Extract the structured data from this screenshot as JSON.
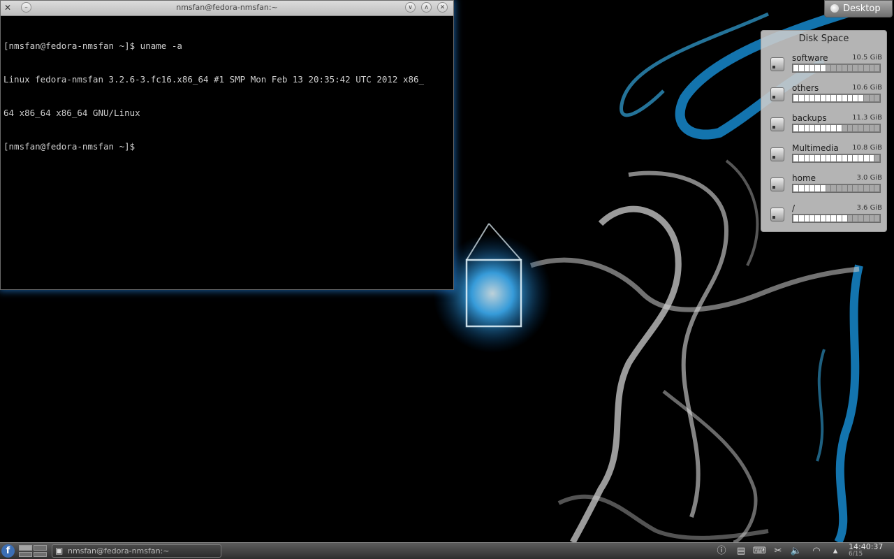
{
  "terminal": {
    "title": "nmsfan@fedora-nmsfan:~",
    "lines": [
      "[nmsfan@fedora-nmsfan ~]$ uname -a",
      "Linux fedora-nmsfan 3.2.6-3.fc16.x86_64 #1 SMP Mon Feb 13 20:35:42 UTC 2012 x86_",
      "64 x86_64 x86_64 GNU/Linux",
      "[nmsfan@fedora-nmsfan ~]$"
    ],
    "buttons": [
      "chevron-down-icon",
      "chevron-up-icon",
      "close-icon"
    ]
  },
  "desktop_button": {
    "label": "Desktop"
  },
  "disk_widget": {
    "title": "Disk Space",
    "disks": [
      {
        "name": "software",
        "size": "10.5 GiB",
        "used_fraction": 0.4
      },
      {
        "name": "others",
        "size": "10.6 GiB",
        "used_fraction": 0.8
      },
      {
        "name": "backups",
        "size": "11.3 GiB",
        "used_fraction": 0.55
      },
      {
        "name": "Multimedia",
        "size": "10.8 GiB",
        "used_fraction": 0.95
      },
      {
        "name": "home",
        "size": "3.0 GiB",
        "used_fraction": 0.4
      },
      {
        "name": "/",
        "size": "3.6 GiB",
        "used_fraction": 0.65
      }
    ]
  },
  "panel": {
    "task_label": "nmsfan@fedora-nmsfan:~",
    "clock_time": "14:40:37",
    "clock_date": "6/15",
    "tray_icons": [
      "info-icon",
      "notes-icon",
      "keyboard-icon",
      "clipboard-icon",
      "volume-icon",
      "wifi-icon",
      "expand-icon"
    ]
  }
}
